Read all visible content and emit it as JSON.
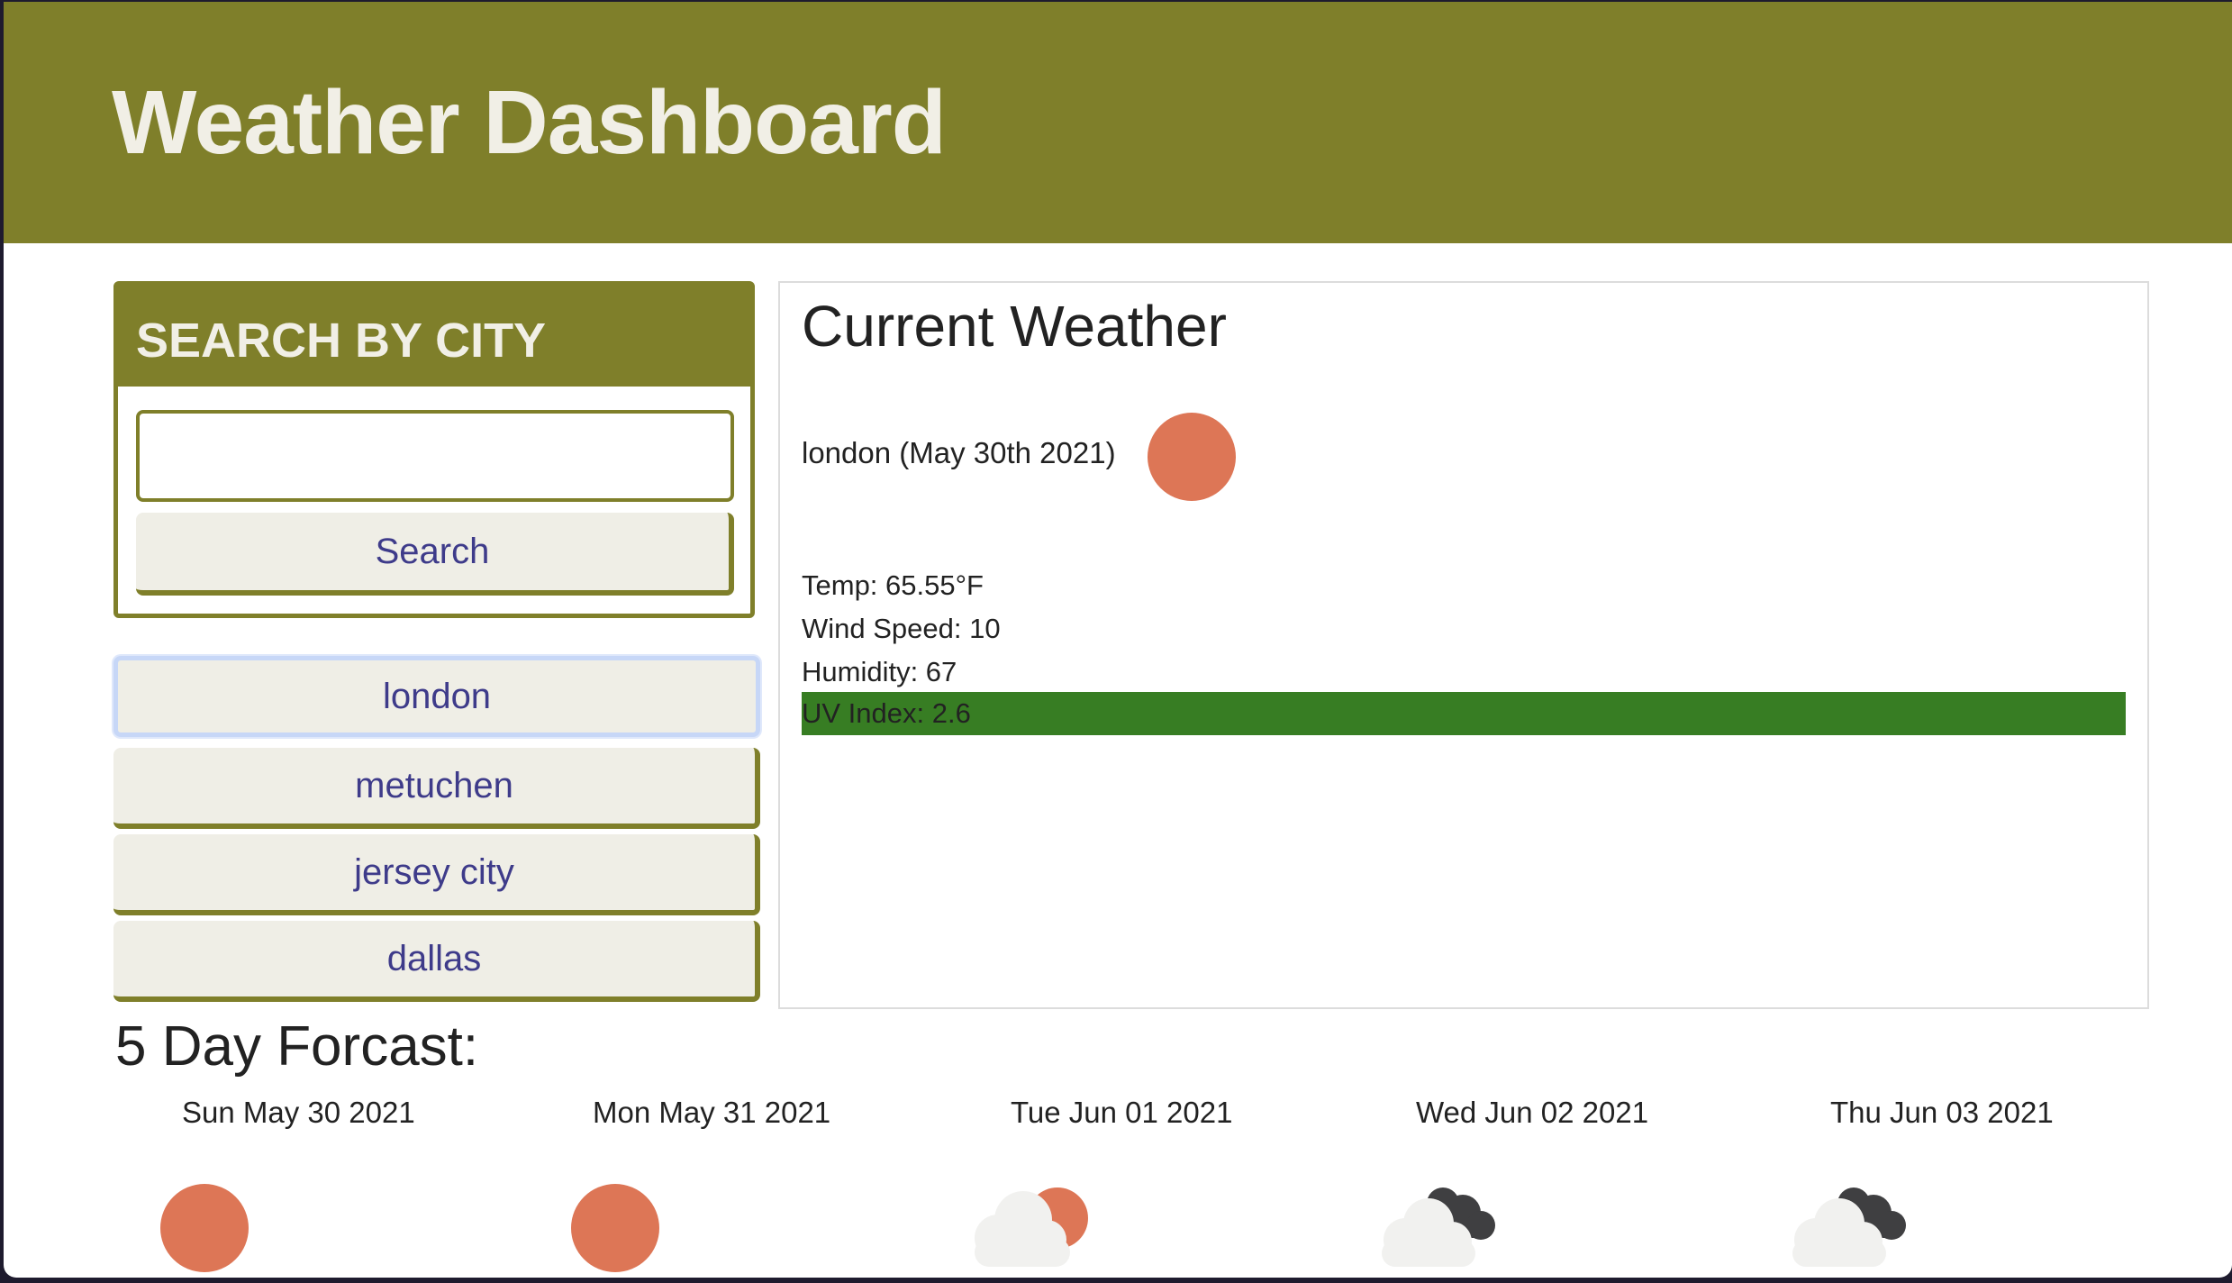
{
  "header": {
    "title": "Weather Dashboard"
  },
  "search": {
    "heading": "SEARCH BY CITY",
    "input_value": "",
    "button_label": "Search"
  },
  "history": [
    {
      "label": "london",
      "active": true
    },
    {
      "label": "metuchen",
      "active": false
    },
    {
      "label": "jersey city",
      "active": false
    },
    {
      "label": "dallas",
      "active": false
    }
  ],
  "current": {
    "heading": "Current Weather",
    "city_date": "london (May 30th 2021)",
    "icon": "sun-icon",
    "temp": "Temp: 65.55°F",
    "wind": "Wind Speed: 10",
    "humidity": "Humidity: 67",
    "uv": "UV Index: 2.6"
  },
  "forecast": {
    "title": "5 Day Forcast:",
    "days": [
      {
        "date": "Sun May 30 2021",
        "icon": "sun-icon"
      },
      {
        "date": "Mon May 31 2021",
        "icon": "sun-icon"
      },
      {
        "date": "Tue Jun 01 2021",
        "icon": "partly-cloudy-icon"
      },
      {
        "date": "Wed Jun 02 2021",
        "icon": "cloudy-icon"
      },
      {
        "date": "Thu Jun 03 2021",
        "icon": "cloudy-icon"
      }
    ]
  },
  "colors": {
    "accent": "#7f7f2a",
    "button_bg": "#efeee6",
    "button_text": "#3e3b8a",
    "uv_bar": "#377d23",
    "sun": "#dd7656"
  }
}
